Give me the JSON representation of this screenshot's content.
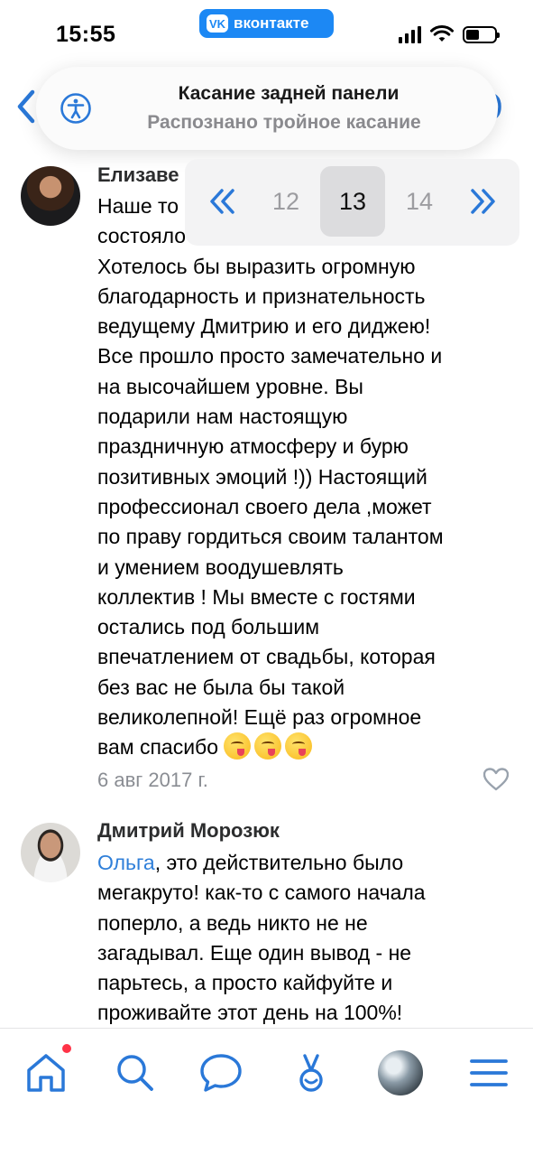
{
  "status_bar": {
    "time": "15:55",
    "app_badge": "вконтакте",
    "app_logo": "VK"
  },
  "banner": {
    "icon": "accessibility-icon",
    "title": "Касание задней панели",
    "subtitle": "Распознано тройное касание"
  },
  "page_picker": {
    "prev_icon": "double-chevron-left-icon",
    "next_icon": "double-chevron-right-icon",
    "pages": [
      "12",
      "13",
      "14"
    ],
    "current": "13"
  },
  "comments": [
    {
      "author": "Елизаве",
      "lines": [
        "Наше то",
        "состояло",
        "Хотелось бы выразить огромную",
        "благодарность и признательность",
        "ведущему Дмитрию и его диджею!",
        "Все прошло просто замечательно и",
        "на высочайшем уровне. Вы",
        "подарили нам настоящую",
        "праздничную атмосферу и бурю",
        "позитивных эмоций !)) Настоящий",
        "профессионал своего дела ,может",
        "по праву гордиться своим талантом",
        "и умением воодушевлять",
        "коллектив ! Мы вместе с гостями",
        "остались под большим",
        "впечатлением от свадьбы, которая",
        "без вас не была бы такой",
        "великолепной! Ещё раз огромное",
        "вам спасибо"
      ],
      "emoji": [
        "face-savoring-food-emoji",
        "face-savoring-food-emoji",
        "face-savoring-food-emoji"
      ],
      "date": "6 авг 2017 г."
    },
    {
      "author": "Дмитрий Морозюк",
      "mention": "Ольга",
      "first_line_rest": ", это действительно было",
      "lines": [
        "мегакруто! как-то с самого начала",
        "поперло, а ведь никто не не",
        "загадывал. Еще один вывод - не",
        "парьтесь, а просто кайфуйте и",
        "проживайте этот день на 100%!"
      ]
    }
  ],
  "tab_bar": {
    "items": [
      "home-icon",
      "search-icon",
      "messages-icon",
      "clips-icon",
      "profile-avatar",
      "menu-icon"
    ],
    "home_badge": true,
    "accent_color": "#2a78d8"
  }
}
